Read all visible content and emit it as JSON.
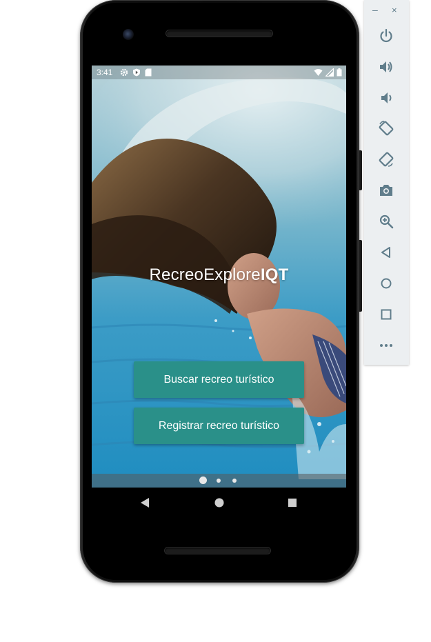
{
  "status_bar": {
    "time": "3:41",
    "left_icons": [
      "settings-icon",
      "shield-play-icon",
      "sd-card-icon"
    ],
    "right_icons": [
      "wifi-icon",
      "signal-icon",
      "battery-icon"
    ]
  },
  "app": {
    "title_regular": "RecreoExplore",
    "title_bold": "IQT",
    "buttons": {
      "search_label": "Buscar recreo turístico",
      "register_label": "Registrar recreo turístico"
    },
    "pager": {
      "page_count": 3,
      "active_index": 0
    },
    "accent_color": "#2a9089"
  },
  "nav_bar": [
    "back-icon",
    "home-icon",
    "overview-icon"
  ],
  "emulator_panel": {
    "window_controls": {
      "minimize": "–",
      "close": "×"
    },
    "items": [
      "power-icon",
      "volume-up-icon",
      "volume-down-icon",
      "rotate-left-icon",
      "rotate-right-icon",
      "camera-icon",
      "zoom-icon",
      "back-icon",
      "home-icon",
      "overview-icon",
      "more-icon"
    ]
  }
}
